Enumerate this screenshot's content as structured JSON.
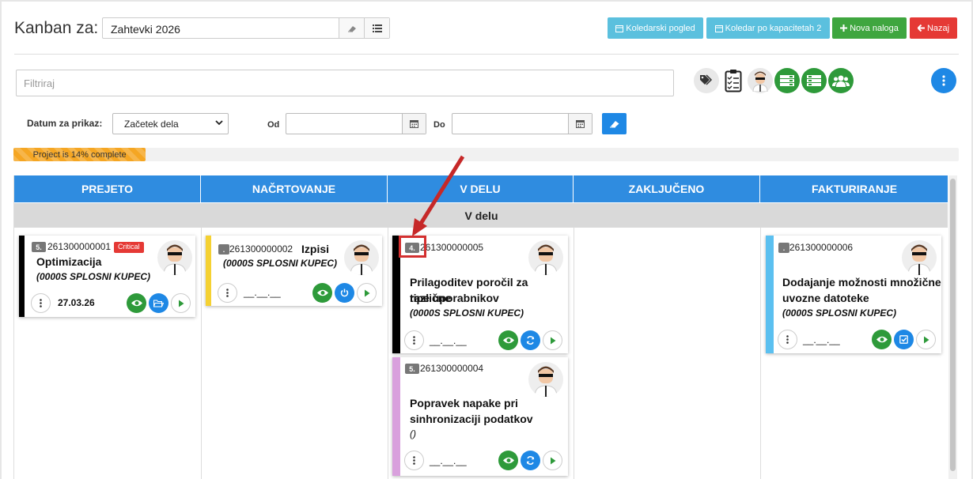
{
  "header": {
    "title": "Kanban za:",
    "board_name": "Zahtevki 2026",
    "buttons": {
      "calendar": "Koledarski pogled",
      "capacity_calendar": "Koledar po kapacitetah 2",
      "new_order": "Nova naloga",
      "back": "Nazaj"
    }
  },
  "filter": {
    "placeholder": "Filtriraj"
  },
  "date_filter": {
    "label": "Datum za prikaz:",
    "selected": "Začetek dela",
    "from_label": "Od",
    "to_label": "Do",
    "from_value": "",
    "to_value": ""
  },
  "progress": {
    "label": "Project is 14% complete",
    "percent": 14
  },
  "columns": [
    "PREJETO",
    "NAČRTOVANJE",
    "V DELU",
    "ZAKLJUČENO",
    "FAKTURIRANJE"
  ],
  "swimlane": "V delu",
  "cards": {
    "c1": {
      "priority": "5.",
      "number": "261300000001",
      "badge": "Critical",
      "title": "Optimizacija",
      "client": "(0000S SPLOSNI KUPEC)",
      "date": "27.03.26",
      "color": "#000000"
    },
    "c2": {
      "priority": ".",
      "number": "261300000002",
      "title": "Izpisi",
      "client": "(0000S SPLOSNI KUPEC)",
      "date": "__.__.__",
      "color": "#f5d132"
    },
    "c3": {
      "priority": "4.",
      "number": "261300000005",
      "title_l1": "Prilagoditev poročil za različne",
      "title_l2": "tipe uporabnikov",
      "client": "(0000S SPLOSNI KUPEC)",
      "date": "__.__.__",
      "color": "#000000"
    },
    "c4": {
      "priority": "5.",
      "number": "261300000004",
      "title_l1": "Popravek napake pri",
      "title_l2": "sinhronizaciji podatkov",
      "client": "()",
      "date": "__.__.__",
      "color": "#d9a0dd"
    },
    "c5": {
      "priority": ".",
      "number": "261300000006",
      "title_l1": "Dodajanje možnosti množične",
      "title_l2": "uvozne datoteke",
      "client": "(0000S SPLOSNI KUPEC)",
      "date": "__.__.__",
      "color": "#5bc0f0"
    }
  },
  "colors": {
    "primary_blue": "#2f8ce0",
    "green": "#2e9a3a",
    "info": "#5bc0de",
    "danger": "#e53935",
    "progress": "#f5a623",
    "annotation": "#d32f2f"
  }
}
